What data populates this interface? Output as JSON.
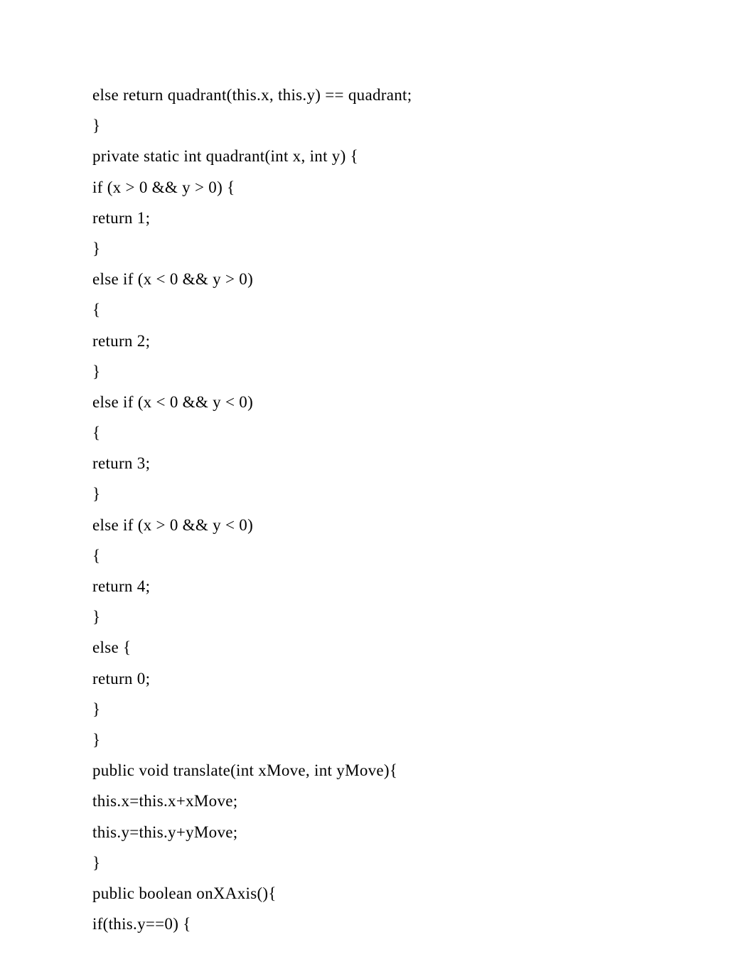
{
  "code": {
    "lines": [
      "else return quadrant(this.x, this.y) == quadrant;",
      "}",
      "private static int quadrant(int x, int y) {",
      "if (x > 0 && y > 0) {",
      "return 1;",
      "}",
      "else if (x < 0 && y > 0)",
      "{",
      "return 2;",
      "}",
      "else if (x < 0 && y < 0)",
      "{",
      "return 3;",
      "}",
      "else if (x > 0 && y < 0)",
      "{",
      "return 4;",
      "}",
      "else {",
      "return 0;",
      "}",
      "}",
      "public void translate(int xMove, int yMove){",
      "this.x=this.x+xMove;",
      "this.y=this.y+yMove;",
      "}",
      "public boolean onXAxis(){",
      "if(this.y==0) {"
    ]
  }
}
